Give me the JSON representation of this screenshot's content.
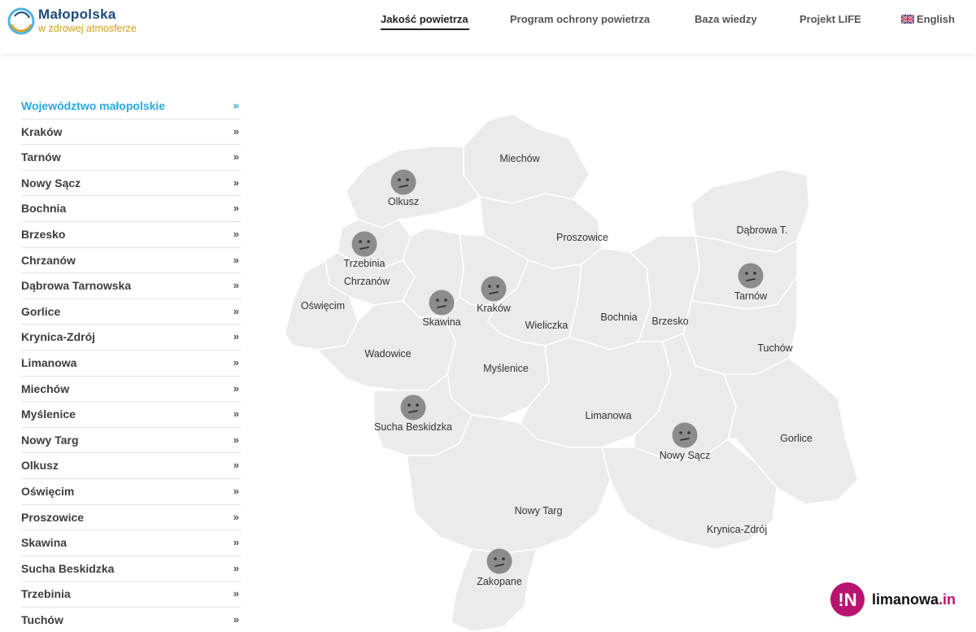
{
  "header": {
    "logo_title": "Małopolska",
    "logo_subtitle": "w zdrowej atmosferze",
    "nav": [
      {
        "label": "Jakość powietrza",
        "active": true
      },
      {
        "label": "Program ochrony powietrza",
        "active": false
      },
      {
        "label": "Baza wiedzy",
        "active": false
      },
      {
        "label": "Projekt LIFE",
        "active": false
      },
      {
        "label": "English",
        "active": false
      }
    ]
  },
  "sidebar": {
    "arrow": "»",
    "items": [
      {
        "label": "Województwo małopolskie",
        "active": true
      },
      {
        "label": "Kraków"
      },
      {
        "label": "Tarnów"
      },
      {
        "label": "Nowy Sącz"
      },
      {
        "label": "Bochnia"
      },
      {
        "label": "Brzesko"
      },
      {
        "label": "Chrzanów"
      },
      {
        "label": "Dąbrowa Tarnowska"
      },
      {
        "label": "Gorlice"
      },
      {
        "label": "Krynica-Zdrój"
      },
      {
        "label": "Limanowa"
      },
      {
        "label": "Miechów"
      },
      {
        "label": "Myślenice"
      },
      {
        "label": "Nowy Targ"
      },
      {
        "label": "Olkusz"
      },
      {
        "label": "Oświęcim"
      },
      {
        "label": "Proszowice"
      },
      {
        "label": "Skawina"
      },
      {
        "label": "Sucha Beskidzka"
      },
      {
        "label": "Trzebinia"
      },
      {
        "label": "Tuchów"
      }
    ]
  },
  "map": {
    "labels": {
      "miechow": "Miechów",
      "olkusz": "Olkusz",
      "proszowice": "Proszowice",
      "dabrowa": "Dąbrowa T.",
      "trzebinia": "Trzebinia",
      "chrzanow": "Chrzanów",
      "oswiecim": "Oświęcim",
      "skawina": "Skawina",
      "krakow": "Kraków",
      "wieliczka": "Wieliczka",
      "bochnia": "Bochnia",
      "brzesko": "Brzesko",
      "tarnow": "Tarnów",
      "tuchow": "Tuchów",
      "wadowice": "Wadowice",
      "myslenice": "Myślenice",
      "sucha": "Sucha Beskidzka",
      "limanowa": "Limanowa",
      "nowysacz": "Nowy Sącz",
      "gorlice": "Gorlice",
      "nowytarg": "Nowy Targ",
      "krynica": "Krynica-Zdrój",
      "zakopane": "Zakopane"
    },
    "face_icon": "neutral-face-icon",
    "face_color": "#8c8c8c",
    "region_color": "#ebebeb"
  },
  "watermark": {
    "badge": "!N",
    "name": "limanowa",
    "tld": ".in"
  },
  "colors": {
    "accent": "#2aa9e0",
    "logo_blue": "#1c4a79",
    "logo_gold": "#d4a017",
    "watermark_magenta": "#b8146f"
  }
}
